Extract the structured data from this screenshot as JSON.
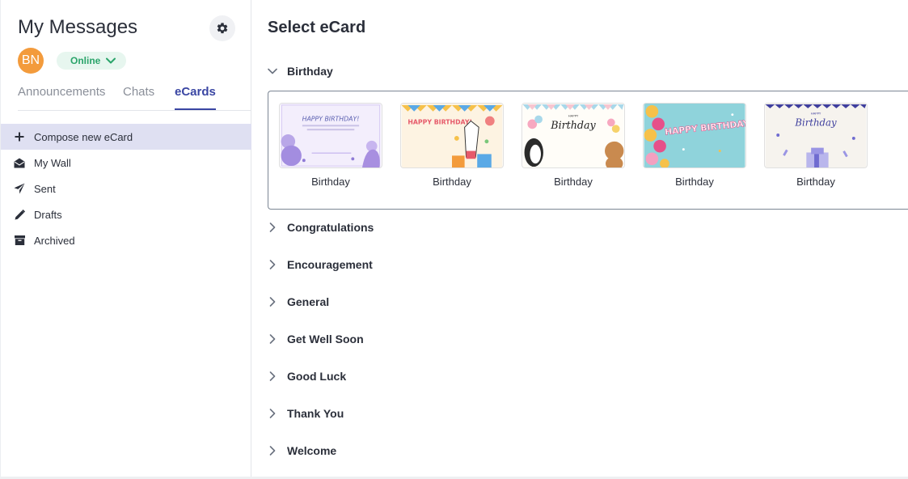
{
  "sidebar": {
    "title": "My Messages",
    "avatar_initials": "BN",
    "avatar_color": "#f39b3c",
    "status": "Online",
    "status_color": "#2aa46a",
    "tabs": [
      {
        "label": "Announcements",
        "active": false
      },
      {
        "label": "Chats",
        "active": false
      },
      {
        "label": "eCards",
        "active": true
      }
    ],
    "nav": [
      {
        "label": "Compose new eCard",
        "icon": "plus-icon",
        "active": true
      },
      {
        "label": "My Wall",
        "icon": "envelope-open-icon",
        "active": false
      },
      {
        "label": "Sent",
        "icon": "paper-plane-icon",
        "active": false
      },
      {
        "label": "Drafts",
        "icon": "pencil-icon",
        "active": false
      },
      {
        "label": "Archived",
        "icon": "archive-box-icon",
        "active": false
      }
    ]
  },
  "main": {
    "title": "Select eCard",
    "expanded_category": {
      "label": "Birthday",
      "cards": [
        {
          "label": "Birthday",
          "thumb_text": "HAPPY BIRTHDAY!"
        },
        {
          "label": "Birthday",
          "thumb_text": "HAPPY BIRTHDAY!"
        },
        {
          "label": "Birthday",
          "thumb_text": "Birthday",
          "thumb_small": "HAPPY"
        },
        {
          "label": "Birthday",
          "thumb_text": "HAPPY BIRTHDAY"
        },
        {
          "label": "Birthday",
          "thumb_text": "Birthday",
          "thumb_small": "HAPPY"
        }
      ]
    },
    "categories": [
      {
        "label": "Congratulations"
      },
      {
        "label": "Encouragement"
      },
      {
        "label": "General"
      },
      {
        "label": "Get Well Soon"
      },
      {
        "label": "Good Luck"
      },
      {
        "label": "Thank You"
      },
      {
        "label": "Welcome"
      }
    ]
  },
  "colors": {
    "accent": "#3a46a3",
    "active_nav_bg": "#dfe0f2",
    "panel_border": "#7c8694"
  }
}
